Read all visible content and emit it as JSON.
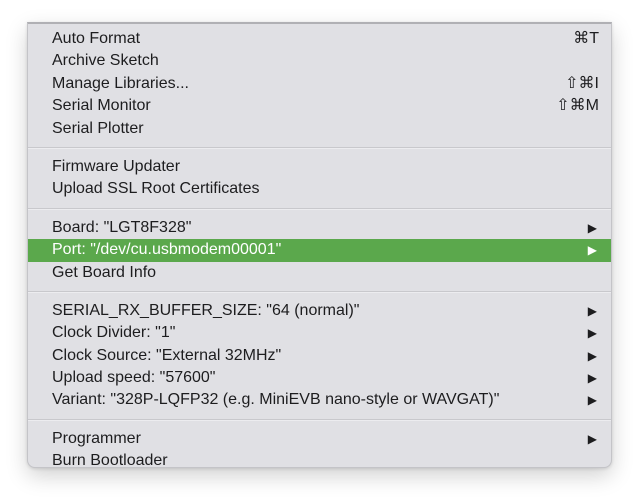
{
  "menu": {
    "groups": [
      [
        {
          "label": "Auto Format",
          "shortcut": "⌘T",
          "submenu": false
        },
        {
          "label": "Archive Sketch",
          "shortcut": "",
          "submenu": false
        },
        {
          "label": "Manage Libraries...",
          "shortcut": "⇧⌘I",
          "submenu": false
        },
        {
          "label": "Serial Monitor",
          "shortcut": "⇧⌘M",
          "submenu": false
        },
        {
          "label": "Serial Plotter",
          "shortcut": "",
          "submenu": false
        }
      ],
      [
        {
          "label": "Firmware Updater",
          "shortcut": "",
          "submenu": false
        },
        {
          "label": "Upload SSL Root Certificates",
          "shortcut": "",
          "submenu": false
        }
      ],
      [
        {
          "label": "Board: \"LGT8F328\"",
          "shortcut": "",
          "submenu": true
        },
        {
          "label": "Port: \"/dev/cu.usbmodem00001\"",
          "shortcut": "",
          "submenu": true,
          "highlighted": true
        },
        {
          "label": "Get Board Info",
          "shortcut": "",
          "submenu": false
        }
      ],
      [
        {
          "label": "SERIAL_RX_BUFFER_SIZE: \"64 (normal)\"",
          "shortcut": "",
          "submenu": true
        },
        {
          "label": "Clock Divider: \"1\"",
          "shortcut": "",
          "submenu": true
        },
        {
          "label": "Clock Source: \"External 32MHz\"",
          "shortcut": "",
          "submenu": true
        },
        {
          "label": "Upload speed: \"57600\"",
          "shortcut": "",
          "submenu": true
        },
        {
          "label": "Variant: \"328P-LQFP32 (e.g. MiniEVB nano-style or WAVGAT)\"",
          "shortcut": "",
          "submenu": true
        }
      ],
      [
        {
          "label": "Programmer",
          "shortcut": "",
          "submenu": true
        },
        {
          "label": "Burn Bootloader",
          "shortcut": "",
          "submenu": false
        }
      ]
    ],
    "submenu_arrow": "▶",
    "highlight_color": "#5ba84c"
  }
}
